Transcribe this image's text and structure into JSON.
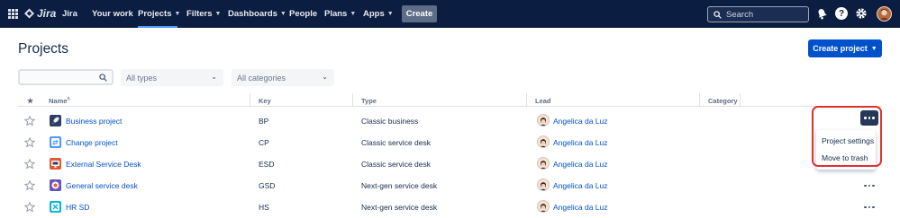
{
  "topnav": {
    "logo": "Jira",
    "items": [
      {
        "label": "Your work",
        "chevron": false
      },
      {
        "label": "Projects",
        "chevron": true,
        "active": true
      },
      {
        "label": "Filters",
        "chevron": true
      },
      {
        "label": "Dashboards",
        "chevron": true
      },
      {
        "label": "People",
        "chevron": false
      },
      {
        "label": "Plans",
        "chevron": true
      },
      {
        "label": "Apps",
        "chevron": true
      }
    ],
    "create_label": "Create",
    "search_placeholder": "Search",
    "bg_color": "#0b1d40"
  },
  "page": {
    "title": "Projects",
    "create_project_label": "Create project"
  },
  "filters": {
    "search_value": "",
    "type_select": "All types",
    "category_select": "All categories"
  },
  "table": {
    "headers": {
      "star": "★",
      "name": "Name",
      "key": "Key",
      "type": "Type",
      "lead": "Lead",
      "category": "Category"
    },
    "rows": [
      {
        "name": "Business project",
        "key": "BP",
        "type": "Classic business",
        "lead": "Angelica da Luz",
        "icon": "rocket-icon",
        "icon_color": "#2c3e66",
        "menu_open": true
      },
      {
        "name": "Change project",
        "key": "CP",
        "type": "Classic service desk",
        "lead": "Angelica da Luz",
        "icon": "swap-icon",
        "icon_color": "#4c9aff",
        "menu_open": false
      },
      {
        "name": "External Service Desk",
        "key": "ESD",
        "type": "Classic service desk",
        "lead": "Angelica da Luz",
        "icon": "desk-icon",
        "icon_color": "#e35b2d",
        "menu_open": false
      },
      {
        "name": "General service desk",
        "key": "GSD",
        "type": "Next-gen service desk",
        "lead": "Angelica da Luz",
        "icon": "lifebuoy-icon",
        "icon_color": "#6554c0",
        "menu_open": false
      },
      {
        "name": "HR SD",
        "key": "HS",
        "type": "Next-gen service desk",
        "lead": "Angelica da Luz",
        "icon": "plus-cross-icon",
        "icon_color": "#00b8d9",
        "menu_open": false
      }
    ]
  },
  "row_menu": {
    "items": [
      "Project settings",
      "Move to trash"
    ]
  },
  "colors": {
    "link": "#0052cc",
    "primary_button": "#0052cc",
    "highlight": "#e03131"
  }
}
